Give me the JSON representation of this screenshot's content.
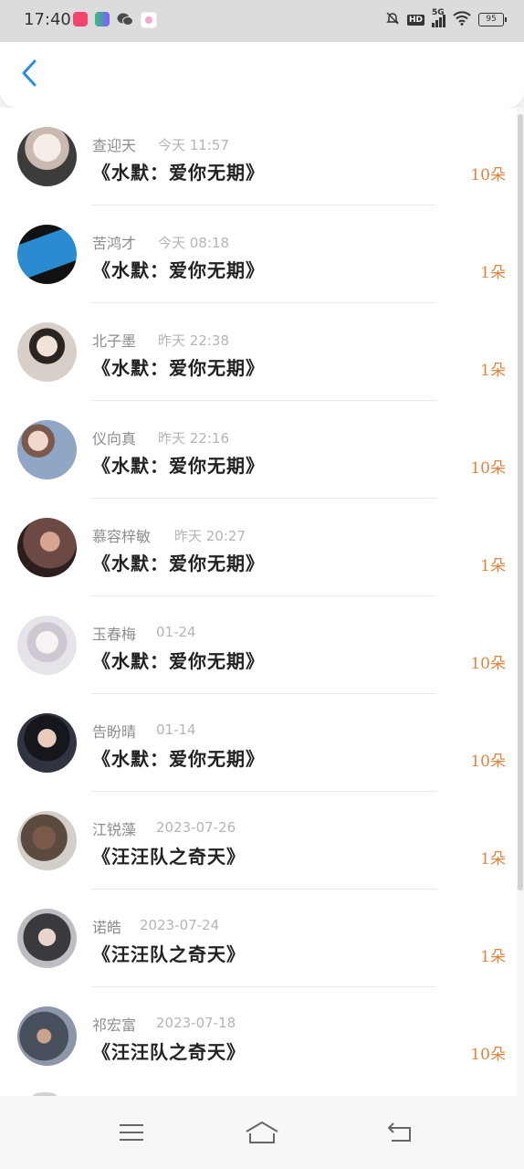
{
  "status_bar": {
    "time": "17:40",
    "signal": "5G",
    "hd": "HD",
    "battery": "95",
    "apps": [
      {
        "icon": "app-red-icon",
        "color": "#f2456b"
      },
      {
        "icon": "app-colorful-icon",
        "color": "#34c07a"
      },
      {
        "icon": "wechat-icon",
        "color": "#4b4b4b"
      },
      {
        "icon": "app-pink-icon",
        "color": "#f4a7d0"
      }
    ]
  },
  "header": {
    "back_icon": "chevron-left-icon",
    "accent": "#2b8fe0"
  },
  "gifts": [
    {
      "sender": "查迎天",
      "time": "今天 11:57",
      "title": "《水默：爱你无期》",
      "count": "10朵",
      "avatar_color": "#c9b9b0"
    },
    {
      "sender": "苦鸿才",
      "time": "今天 08:18",
      "title": "《水默：爱你无期》",
      "count": "1朵",
      "avatar_color": "#2a8bd0"
    },
    {
      "sender": "北子墨",
      "time": "昨天 22:38",
      "title": "《水默：爱你无期》",
      "count": "1朵",
      "avatar_color": "#d8cfc9"
    },
    {
      "sender": "仪向真",
      "time": "昨天 22:16",
      "title": "《水默：爱你无期》",
      "count": "10朵",
      "avatar_color": "#8fa7c5"
    },
    {
      "sender": "慕容梓敏",
      "time": "昨天 20:27",
      "title": "《水默：爱你无期》",
      "count": "1朵",
      "avatar_color": "#6b4a45"
    },
    {
      "sender": "玉春梅",
      "time": "01-24",
      "title": "《水默：爱你无期》",
      "count": "10朵",
      "avatar_color": "#e6e3ea"
    },
    {
      "sender": "告盼晴",
      "time": "01-14",
      "title": "《水默：爱你无期》",
      "count": "10朵",
      "avatar_color": "#2f3440"
    },
    {
      "sender": "江锐藻",
      "time": "2023-07-26",
      "title": "《汪汪队之奇天》",
      "count": "1朵",
      "avatar_color": "#5a4a40"
    },
    {
      "sender": "诺皓",
      "time": "2023-07-24",
      "title": "《汪汪队之奇天》",
      "count": "1朵",
      "avatar_color": "#3a3a3e"
    },
    {
      "sender": "祁宏富",
      "time": "2023-07-18",
      "title": "《汪汪队之奇天》",
      "count": "10朵",
      "avatar_color": "#49505d"
    }
  ],
  "nav": {
    "menu_icon": "menu-icon",
    "home_icon": "home-icon",
    "back_icon": "back-icon"
  }
}
